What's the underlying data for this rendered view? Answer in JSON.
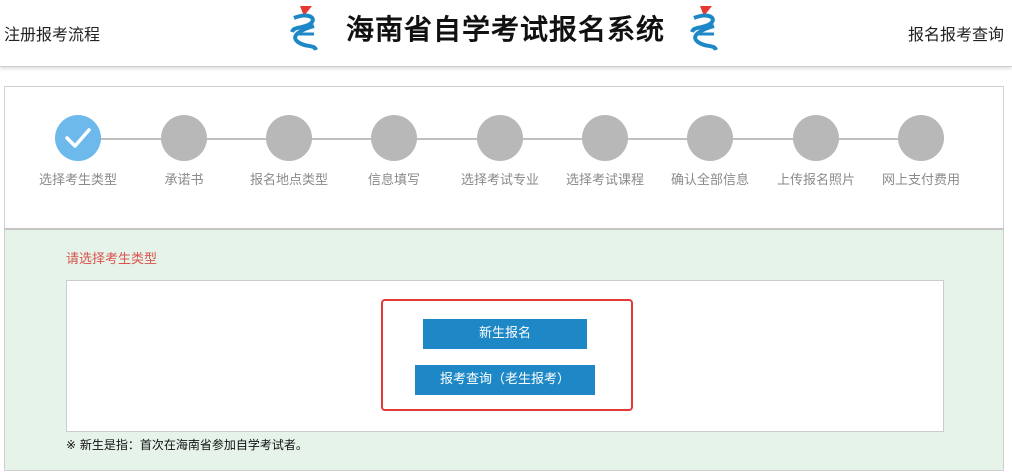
{
  "header": {
    "left_link": "注册报考流程",
    "title": "海南省自学考试报名系统",
    "right_link": "报名报考查询"
  },
  "steps": [
    {
      "label": "选择考生类型",
      "state": "done"
    },
    {
      "label": "承诺书",
      "state": "pending"
    },
    {
      "label": "报名地点类型",
      "state": "pending"
    },
    {
      "label": "信息填写",
      "state": "pending"
    },
    {
      "label": "选择考试专业",
      "state": "pending"
    },
    {
      "label": "选择考试课程",
      "state": "pending"
    },
    {
      "label": "确认全部信息",
      "state": "pending"
    },
    {
      "label": "上传报名照片",
      "state": "pending"
    },
    {
      "label": "网上支付费用",
      "state": "pending"
    }
  ],
  "form": {
    "section_title": "请选择考生类型",
    "new_button": "新生报名",
    "query_button": "报考查询（老生报考）",
    "note": "※ 新生是指：首次在海南省参加自学考试者。"
  },
  "colors": {
    "accent_blue": "#1e88c7",
    "done_step": "#6db9ec",
    "pending_step": "#b8b8b8",
    "section_title": "#d9534f",
    "highlight": "#e53935",
    "form_bg": "#e6f3e9"
  },
  "icons": {
    "logo": "hainan-exam-logo-icon",
    "step_done": "checkmark-icon"
  }
}
